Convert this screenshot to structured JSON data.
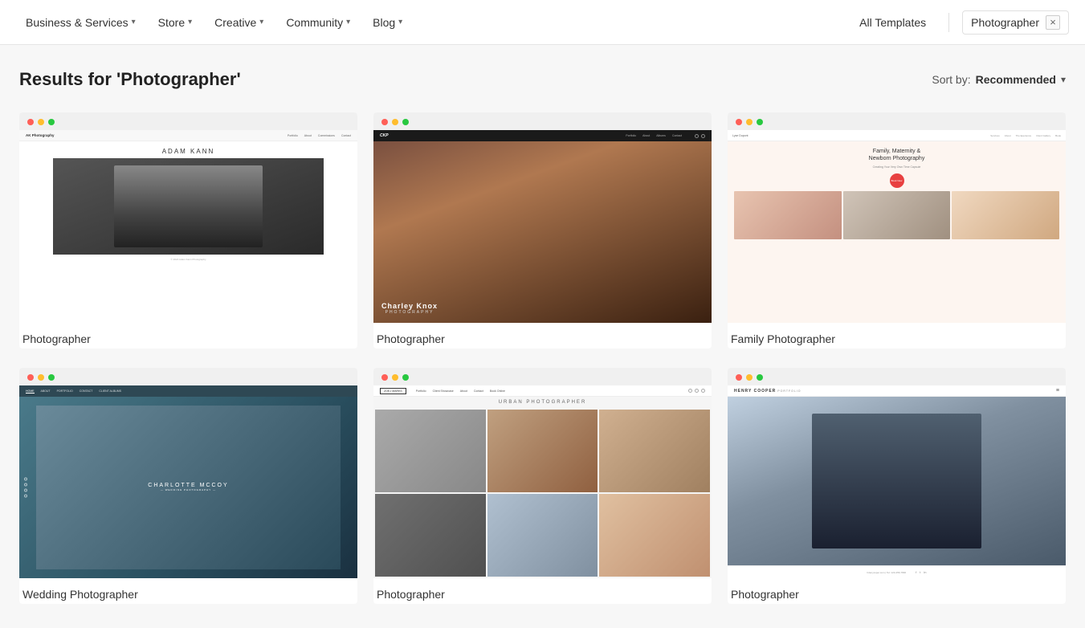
{
  "nav": {
    "items": [
      {
        "label": "Business & Services",
        "has_dropdown": true
      },
      {
        "label": "Store",
        "has_dropdown": true
      },
      {
        "label": "Creative",
        "has_dropdown": true
      },
      {
        "label": "Community",
        "has_dropdown": true
      },
      {
        "label": "Blog",
        "has_dropdown": true
      }
    ],
    "all_templates": "All Templates",
    "search_query": "Photographer",
    "close_label": "×"
  },
  "results": {
    "title": "Results for 'Photographer'",
    "sort_label": "Sort by:",
    "sort_value": "Recommended",
    "templates": [
      {
        "id": 1,
        "name": "Photographer",
        "mock_type": "mock-1"
      },
      {
        "id": 2,
        "name": "Photographer",
        "mock_type": "mock-2"
      },
      {
        "id": 3,
        "name": "Family Photographer",
        "mock_type": "mock-3"
      },
      {
        "id": 4,
        "name": "Wedding Photographer",
        "mock_type": "mock-4"
      },
      {
        "id": 5,
        "name": "Photographer",
        "mock_type": "mock-5"
      },
      {
        "id": 6,
        "name": "Photographer",
        "mock_type": "mock-6"
      }
    ]
  }
}
